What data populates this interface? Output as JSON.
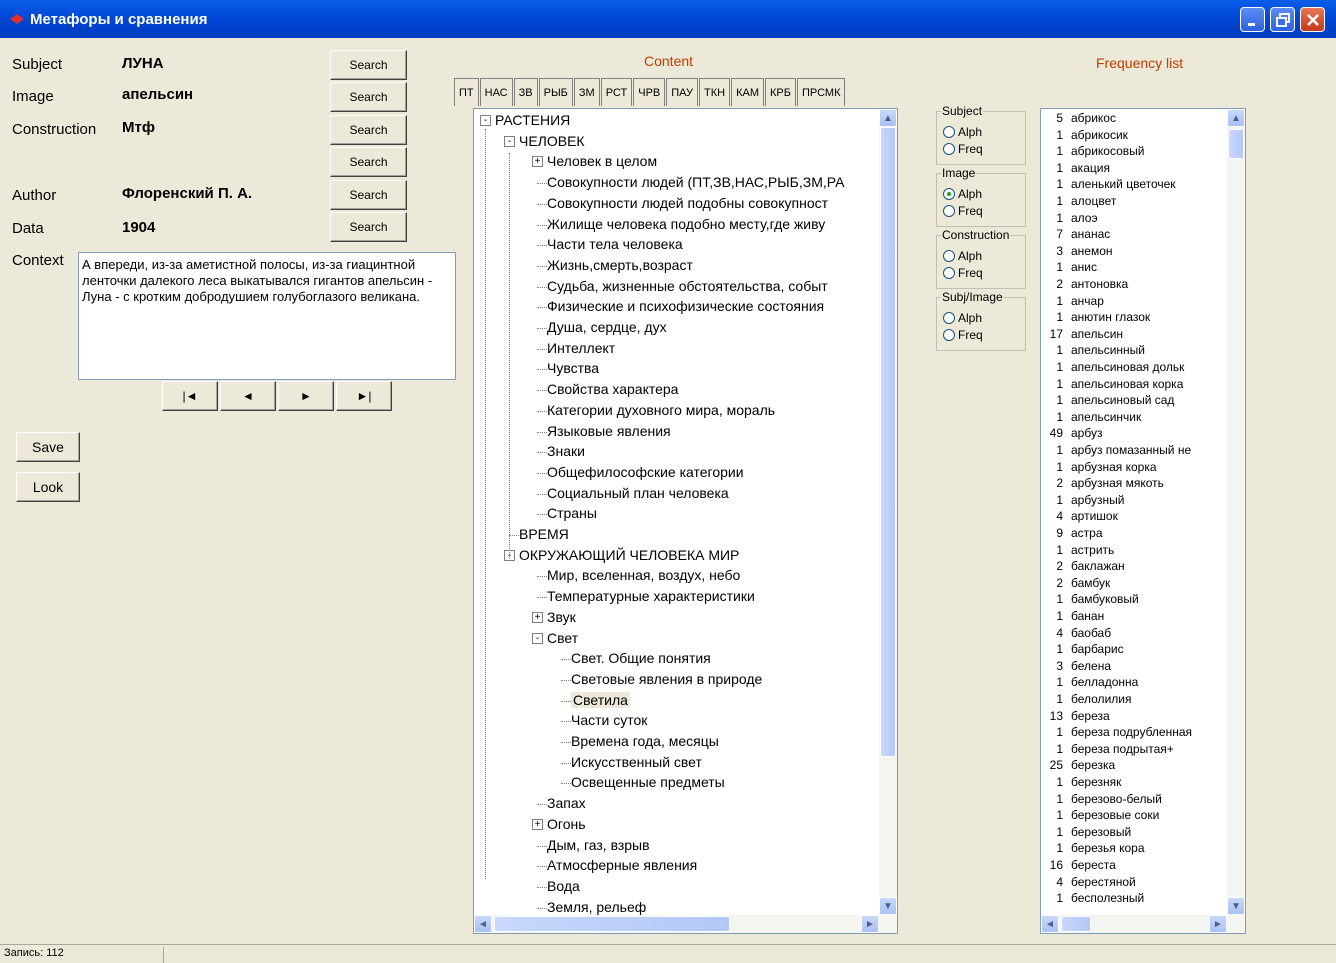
{
  "window": {
    "title": "Метафоры и сравнения"
  },
  "fields": {
    "subject": {
      "label": "Subject",
      "value": "ЛУНА"
    },
    "image": {
      "label": "Image",
      "value": "апельсин"
    },
    "construction": {
      "label": "Construction",
      "value": "Мтф"
    },
    "author": {
      "label": "Author",
      "value": "Флоренский П. А."
    },
    "data": {
      "label": "Data",
      "value": "1904"
    },
    "context": {
      "label": "Context",
      "value": "А впереди, из-за аметистной полосы, из-за гиацинтной ленточки далекого леса выкатывался гигантов апельсин - Луна - с кротким добродушием голубоглазого великана."
    }
  },
  "search_buttons": [
    "Search",
    "Search",
    "Search",
    "Search",
    "Search",
    "Search"
  ],
  "nav_buttons": [
    "|◄",
    "◄",
    "►",
    "►|"
  ],
  "save_label": "Save",
  "look_label": "Look",
  "content_heading": "Content",
  "frequency_heading": "Frequency list",
  "tabs": [
    "ПТ",
    "НАС",
    "ЗВ",
    "РЫБ",
    "ЗМ",
    "РСТ",
    "ЧРВ",
    "ПАУ",
    "ТКН",
    "КАМ",
    "КРБ",
    "ПРСМК"
  ],
  "tree": [
    {
      "level": 0,
      "sign": "-",
      "label": "РАСТЕНИЯ"
    },
    {
      "level": 1,
      "sign": "-",
      "label": "ЧЕЛОВЕК"
    },
    {
      "level": 2,
      "sign": "+",
      "label": "Человек в целом"
    },
    {
      "level": 2,
      "sign": "",
      "label": "Совокупности людей (ПТ,ЗВ,НАС,РЫБ,ЗМ,РА"
    },
    {
      "level": 2,
      "sign": "",
      "label": "Совокупности людей подобны совокупност"
    },
    {
      "level": 2,
      "sign": "",
      "label": "Жилище человека подобно месту,где живу"
    },
    {
      "level": 2,
      "sign": "",
      "label": "Части тела человека"
    },
    {
      "level": 2,
      "sign": "",
      "label": "Жизнь,смерть,возраст"
    },
    {
      "level": 2,
      "sign": "",
      "label": "Судьба, жизненные обстоятельства, событ"
    },
    {
      "level": 2,
      "sign": "",
      "label": "Физические и психофизические состояния"
    },
    {
      "level": 2,
      "sign": "",
      "label": "Душа, сердце, дух"
    },
    {
      "level": 2,
      "sign": "",
      "label": "Интеллект"
    },
    {
      "level": 2,
      "sign": "",
      "label": "Чувства"
    },
    {
      "level": 2,
      "sign": "",
      "label": "Свойства характера"
    },
    {
      "level": 2,
      "sign": "",
      "label": "Категории духовного мира, мораль"
    },
    {
      "level": 2,
      "sign": "",
      "label": "Языковые явления"
    },
    {
      "level": 2,
      "sign": "",
      "label": "Знаки"
    },
    {
      "level": 2,
      "sign": "",
      "label": "Общефилософские категории"
    },
    {
      "level": 2,
      "sign": "",
      "label": "Социальный план человека"
    },
    {
      "level": 2,
      "sign": "",
      "label": "Страны"
    },
    {
      "level": 1,
      "sign": "",
      "label": "ВРЕМЯ"
    },
    {
      "level": 1,
      "sign": "-",
      "label": "ОКРУЖАЮЩИЙ ЧЕЛОВЕКА МИР"
    },
    {
      "level": 2,
      "sign": "",
      "label": "Мир, вселенная, воздух, небо"
    },
    {
      "level": 2,
      "sign": "",
      "label": "Температурные характеристики"
    },
    {
      "level": 2,
      "sign": "+",
      "label": "Звук"
    },
    {
      "level": 2,
      "sign": "-",
      "label": "Свет"
    },
    {
      "level": 3,
      "sign": "",
      "label": "Свет. Общие понятия"
    },
    {
      "level": 3,
      "sign": "",
      "label": "Световые явления в природе"
    },
    {
      "level": 3,
      "sign": "",
      "label": "Светила",
      "selected": true
    },
    {
      "level": 3,
      "sign": "",
      "label": "Части суток"
    },
    {
      "level": 3,
      "sign": "",
      "label": "Времена года, месяцы"
    },
    {
      "level": 3,
      "sign": "",
      "label": "Искусственный свет"
    },
    {
      "level": 3,
      "sign": "",
      "label": "Освещенные предметы"
    },
    {
      "level": 2,
      "sign": "",
      "label": "Запах"
    },
    {
      "level": 2,
      "sign": "+",
      "label": "Огонь"
    },
    {
      "level": 2,
      "sign": "",
      "label": "Дым, газ, взрыв"
    },
    {
      "level": 2,
      "sign": "",
      "label": "Атмосферные явления"
    },
    {
      "level": 2,
      "sign": "",
      "label": "Вода"
    },
    {
      "level": 2,
      "sign": "",
      "label": "Земля, рельеф"
    }
  ],
  "sort_groups": [
    {
      "title": "Subject",
      "options": [
        "Alph",
        "Freq"
      ],
      "selected": -1
    },
    {
      "title": "Image",
      "options": [
        "Alph",
        "Freq"
      ],
      "selected": 0
    },
    {
      "title": "Construction",
      "options": [
        "Alph",
        "Freq"
      ],
      "selected": -1
    },
    {
      "title": "Subj/Image",
      "options": [
        "Alph",
        "Freq"
      ],
      "selected": -1
    }
  ],
  "frequency": [
    [
      "5",
      "абрикос"
    ],
    [
      "1",
      "абрикосик"
    ],
    [
      "1",
      "абрикосовый"
    ],
    [
      "1",
      "акация"
    ],
    [
      "1",
      "аленький цветочек"
    ],
    [
      "1",
      "алоцвет"
    ],
    [
      "1",
      "алоэ"
    ],
    [
      "7",
      "ананас"
    ],
    [
      "3",
      "анемон"
    ],
    [
      "1",
      "анис"
    ],
    [
      "2",
      "антоновка"
    ],
    [
      "1",
      "анчар"
    ],
    [
      "1",
      "анютин глазок"
    ],
    [
      "17",
      "апельсин"
    ],
    [
      "1",
      "апельсинный"
    ],
    [
      "1",
      "апельсиновая дольк"
    ],
    [
      "1",
      "апельсиновая корка"
    ],
    [
      "1",
      "апельсиновый сад"
    ],
    [
      "1",
      "апельсинчик"
    ],
    [
      "49",
      "арбуз"
    ],
    [
      "1",
      "арбуз помазанный не"
    ],
    [
      "1",
      "арбузная корка"
    ],
    [
      "2",
      "арбузная мякоть"
    ],
    [
      "1",
      "арбузный"
    ],
    [
      "4",
      "артишок"
    ],
    [
      "9",
      "астра"
    ],
    [
      "1",
      "астрить"
    ],
    [
      "2",
      "баклажан"
    ],
    [
      "2",
      "бамбук"
    ],
    [
      "1",
      "бамбуковый"
    ],
    [
      "1",
      "банан"
    ],
    [
      "4",
      "баобаб"
    ],
    [
      "1",
      "барбарис"
    ],
    [
      "3",
      "белена"
    ],
    [
      "1",
      "белладонна"
    ],
    [
      "1",
      "белолилия"
    ],
    [
      "13",
      "береза"
    ],
    [
      "1",
      "береза подрубленная"
    ],
    [
      "1",
      "береза подрытая+"
    ],
    [
      "25",
      "березка"
    ],
    [
      "1",
      "березняк"
    ],
    [
      "1",
      "березово-белый"
    ],
    [
      "1",
      "березовые соки"
    ],
    [
      "1",
      "березовый"
    ],
    [
      "1",
      "березья кора"
    ],
    [
      "16",
      "береста"
    ],
    [
      "4",
      "берестяной"
    ],
    [
      "1",
      "бесполезный"
    ]
  ],
  "status": "Запись: 112"
}
